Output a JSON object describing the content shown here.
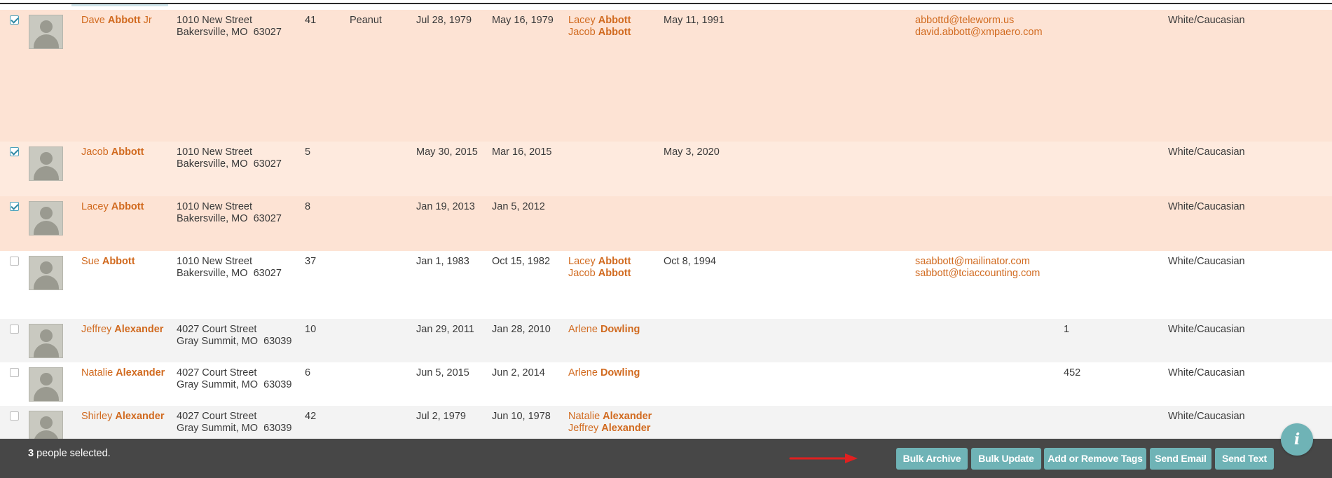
{
  "rows": [
    {
      "selected": true,
      "first": "Dave",
      "last": "Abbott",
      "suffix": " Jr",
      "street": "1010 New Street",
      "city": "Bakersville, MO  63027",
      "age": "41",
      "nickname": "Peanut",
      "dob": "Jul 28, 1979",
      "start": "May 16, 1979",
      "relations": [
        {
          "first": "Lacey",
          "last": "Abbott"
        },
        {
          "first": "Jacob",
          "last": "Abbott"
        }
      ],
      "date": "May 11, 1991",
      "emails": [
        "abbottd@teleworm.us",
        "david.abbott@xmpaero.com"
      ],
      "num": "",
      "ethnicity": "White/Caucasian"
    },
    {
      "selected": true,
      "first": "Jacob",
      "last": "Abbott",
      "suffix": "",
      "street": "1010 New Street",
      "city": "Bakersville, MO  63027",
      "age": "5",
      "nickname": "",
      "dob": "May 30, 2015",
      "start": "Mar 16, 2015",
      "relations": [],
      "date": "May 3, 2020",
      "emails": [],
      "num": "",
      "ethnicity": "White/Caucasian"
    },
    {
      "selected": true,
      "first": "Lacey",
      "last": "Abbott",
      "suffix": "",
      "street": "1010 New Street",
      "city": "Bakersville, MO  63027",
      "age": "8",
      "nickname": "",
      "dob": "Jan 19, 2013",
      "start": "Jan 5, 2012",
      "relations": [],
      "date": "",
      "emails": [],
      "num": "",
      "ethnicity": "White/Caucasian"
    },
    {
      "selected": false,
      "first": "Sue",
      "last": "Abbott",
      "suffix": "",
      "street": "1010 New Street",
      "city": "Bakersville, MO  63027",
      "age": "37",
      "nickname": "",
      "dob": "Jan 1, 1983",
      "start": "Oct 15, 1982",
      "relations": [
        {
          "first": "Lacey",
          "last": "Abbott"
        },
        {
          "first": "Jacob",
          "last": "Abbott"
        }
      ],
      "date": "Oct 8, 1994",
      "emails": [
        "saabbott@mailinator.com",
        "sabbott@tciaccounting.com"
      ],
      "num": "",
      "ethnicity": "White/Caucasian"
    },
    {
      "selected": false,
      "first": "Jeffrey",
      "last": "Alexander",
      "suffix": "",
      "street": "4027 Court Street",
      "city": "Gray Summit, MO  63039",
      "age": "10",
      "nickname": "",
      "dob": "Jan 29, 2011",
      "start": "Jan 28, 2010",
      "relations": [
        {
          "first": "Arlene",
          "last": "Dowling"
        }
      ],
      "date": "",
      "emails": [],
      "num": "1",
      "ethnicity": "White/Caucasian"
    },
    {
      "selected": false,
      "first": "Natalie",
      "last": "Alexander",
      "suffix": "",
      "street": "4027 Court Street",
      "city": "Gray Summit, MO  63039",
      "age": "6",
      "nickname": "",
      "dob": "Jun 5, 2015",
      "start": "Jun 2, 2014",
      "relations": [
        {
          "first": "Arlene",
          "last": "Dowling"
        }
      ],
      "date": "",
      "emails": [],
      "num": "452",
      "ethnicity": "White/Caucasian"
    },
    {
      "selected": false,
      "first": "Shirley",
      "last": "Alexander",
      "suffix": "",
      "street": "4027 Court Street",
      "city": "Gray Summit, MO  63039",
      "age": "42",
      "nickname": "",
      "dob": "Jul 2, 1979",
      "start": "Jun 10, 1978",
      "relations": [
        {
          "first": "Natalie",
          "last": "Alexander"
        },
        {
          "first": "Jeffrey",
          "last": "Alexander"
        }
      ],
      "date": "",
      "emails": [],
      "num": "",
      "ethnicity": "White/Caucasian"
    }
  ],
  "footer": {
    "selected_count": "3",
    "selected_text": " people selected."
  },
  "buttons": {
    "bulk_archive": "Bulk Archive",
    "bulk_update": "Bulk Update",
    "tags": "Add or Remove Tags",
    "send_email": "Send Email",
    "send_text": "Send Text"
  },
  "info_button": {
    "glyph": "i"
  },
  "icons": {
    "avatar": "person-silhouette-icon",
    "arrow": "red-arrow-right-icon",
    "info": "info-icon"
  },
  "colors": {
    "link": "#d16a1f",
    "button": "#6fb3b6",
    "footer": "#474747",
    "selected_row": "#fde3d4",
    "arrow": "#e02020"
  }
}
